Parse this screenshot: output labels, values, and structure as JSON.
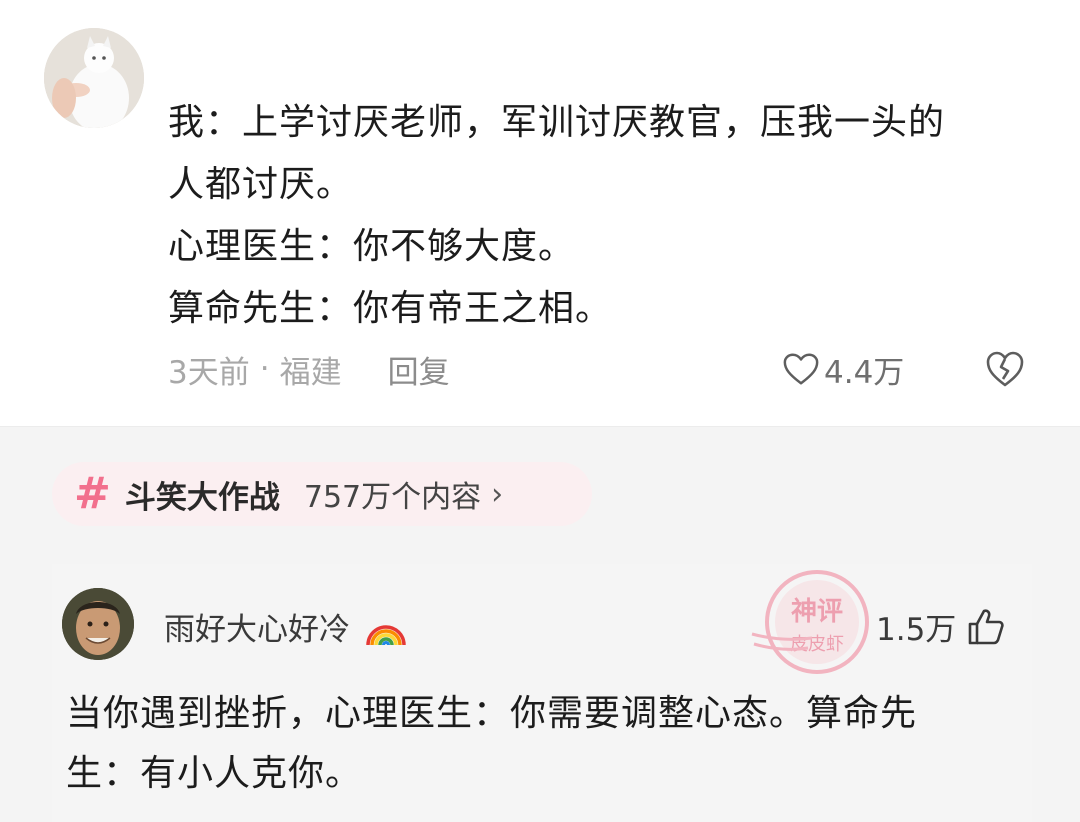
{
  "comment1": {
    "lines": [
      "我：上学讨厌老师，军训讨厌教官，压我一头的",
      "人都讨厌。",
      "心理医生：你不够大度。",
      "算命先生：你有帝王之相。"
    ],
    "time": "3天前",
    "separator": "·",
    "location": "福建",
    "reply_label": "回复",
    "like_count": "4.4万"
  },
  "topic": {
    "hash": "#",
    "name": "斗笑大作战",
    "count": "757万个内容",
    "arrow": "›"
  },
  "comment2": {
    "username": "雨好大心好冷",
    "like_count": "1.5万",
    "lines": [
      "当你遇到挫折，心理医生：你需要调整心态。算命先",
      "生：有小人克你。"
    ]
  },
  "watermark": {
    "text_top": "神评",
    "text_bottom": "皮皮虾"
  },
  "colors": {
    "topic_hash": "#f2708d",
    "topic_bg": "#fbeff1",
    "meta_gray": "#a8a8a8"
  }
}
